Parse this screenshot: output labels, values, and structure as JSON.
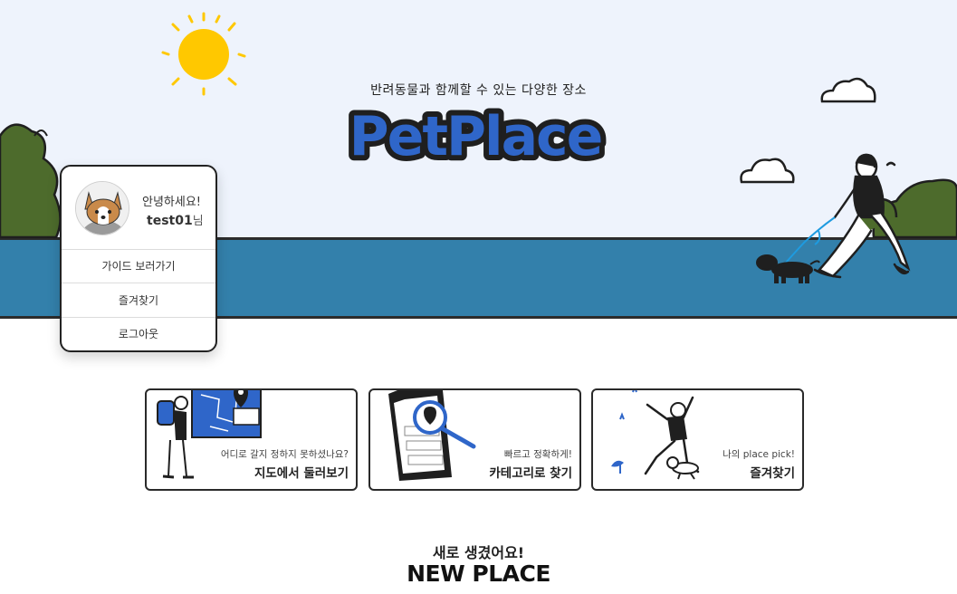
{
  "hero": {
    "tagline": "반려동물과 함께할 수 있는 다양한 장소",
    "logo_text": "PetPlace"
  },
  "profile": {
    "greeting": "안녕하세요!",
    "username": "test01",
    "suffix": "님",
    "menu": [
      {
        "label": "가이드 보러가기"
      },
      {
        "label": "즐겨찾기"
      },
      {
        "label": "로그아웃"
      }
    ]
  },
  "cards": [
    {
      "subtitle": "어디로 갈지 정하지 못하셨나요?",
      "title": "지도에서 둘러보기"
    },
    {
      "subtitle": "빠르고 정확하게!",
      "title": "카테고리로 찾기"
    },
    {
      "subtitle": "나의 place pick!",
      "title": "즐겨찾기"
    }
  ],
  "new_section": {
    "subtitle": "새로 생겼어요!",
    "title": "NEW PLACE"
  },
  "colors": {
    "sky": "#eef3fc",
    "river": "#3380ab",
    "logo_blue": "#2f66c9",
    "bush": "#4d6b2c",
    "sun": "#ffc800"
  }
}
